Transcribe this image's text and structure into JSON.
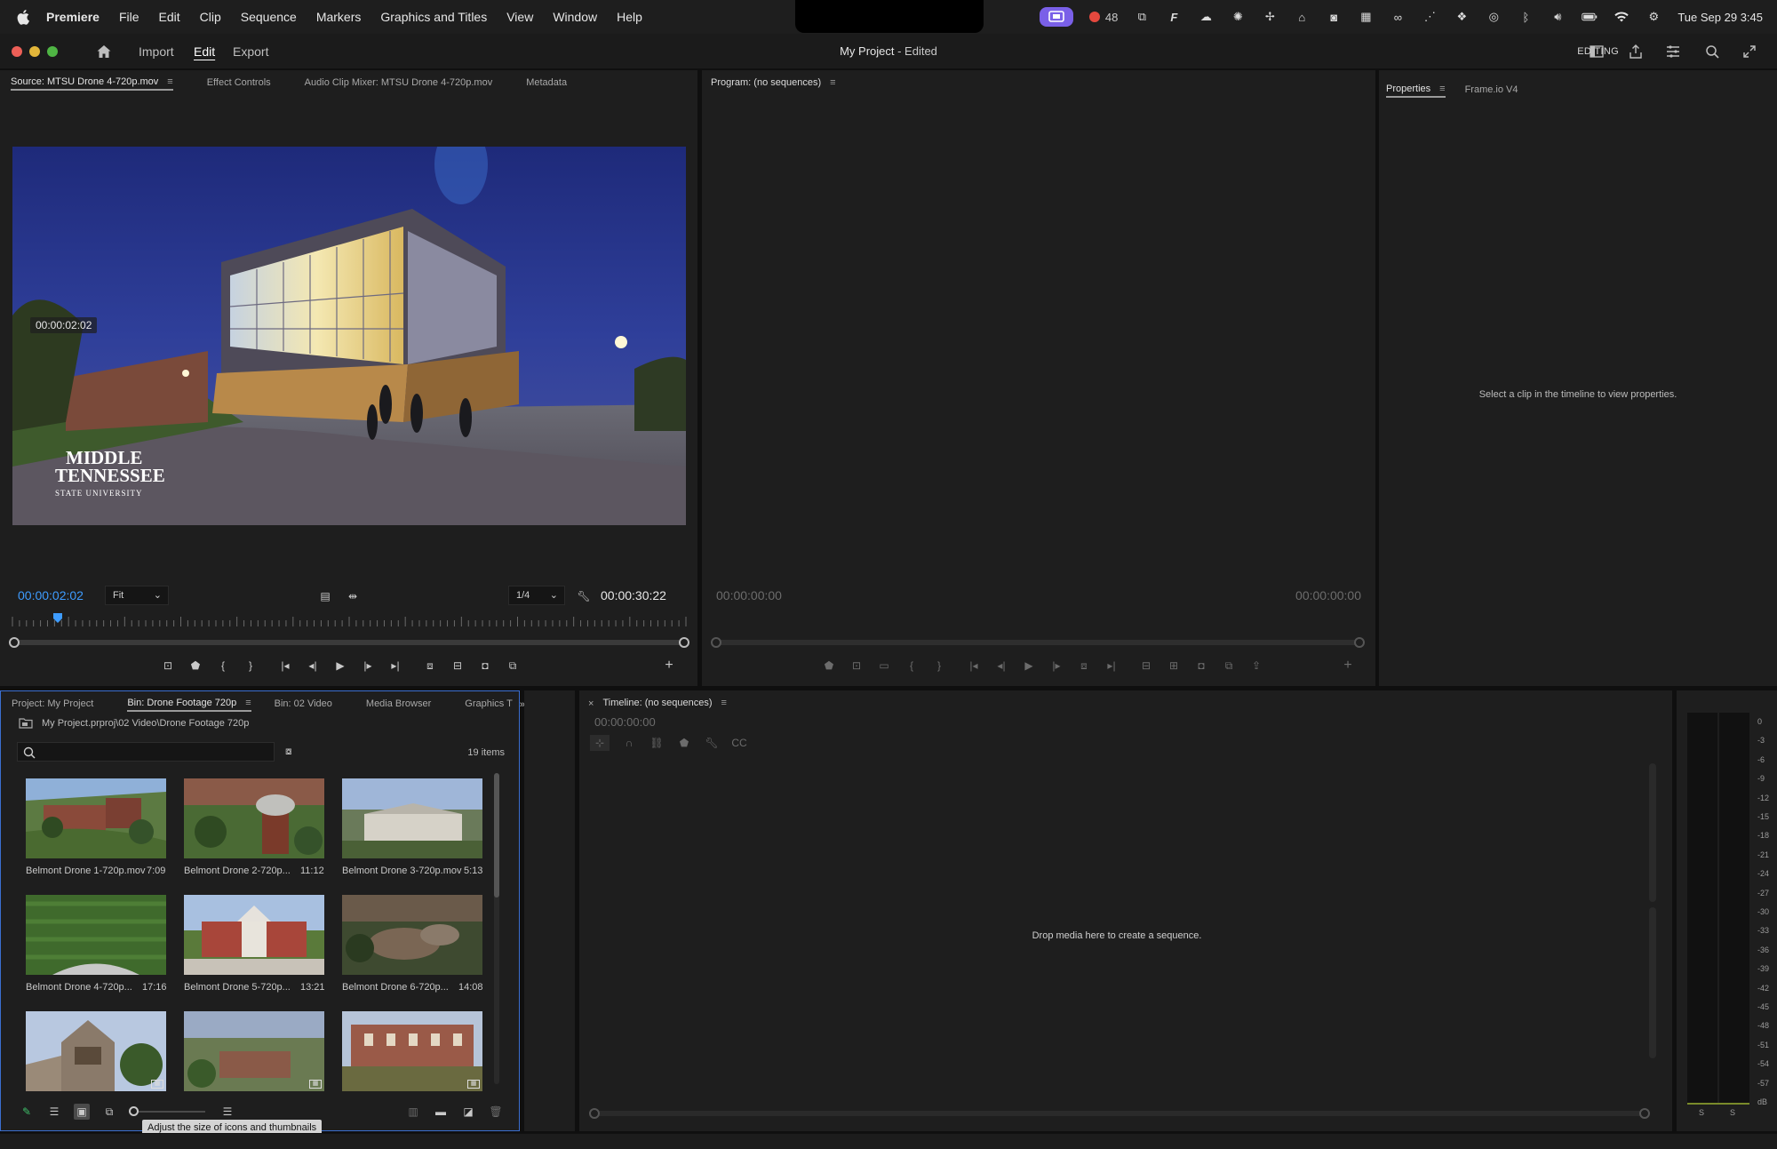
{
  "menubar": {
    "app": "Premiere",
    "items": [
      "File",
      "Edit",
      "Clip",
      "Sequence",
      "Markers",
      "Graphics and Titles",
      "View",
      "Window",
      "Help"
    ],
    "record_count": "48",
    "datetime": "Tue Sep 29  3:45"
  },
  "appbar": {
    "tabs": [
      "Import",
      "Edit",
      "Export"
    ],
    "project_name": "My Project",
    "project_status": " - Edited",
    "workspace": "EDITING"
  },
  "source_panel": {
    "tabs": [
      "Source: MTSU Drone 4-720p.mov",
      "Effect Controls",
      "Audio Clip Mixer: MTSU Drone 4-720p.mov",
      "Metadata"
    ],
    "overlay_timecode": "00:00:02:02",
    "watermark_line1": "MIDDLE",
    "watermark_line2": "TENNESSEE",
    "watermark_line3": "STATE UNIVERSITY",
    "current_timecode": "00:00:02:02",
    "zoom": "Fit",
    "resolution": "1/4",
    "duration": "00:00:30:22",
    "playhead_fraction": 0.067
  },
  "program_panel": {
    "tab": "Program: (no sequences)",
    "timecode_left": "00:00:00:00",
    "timecode_right": "00:00:00:00"
  },
  "properties_panel": {
    "tabs": [
      "Properties",
      "Frame.io V4"
    ],
    "empty_message": "Select a clip in the timeline to view properties."
  },
  "project_panel": {
    "tabs": [
      "Project: My Project",
      "Bin: Drone Footage 720p",
      "Bin: 02 Video",
      "Media Browser",
      "Graphics T"
    ],
    "path": "My Project.prproj\\02 Video\\Drone Footage 720p",
    "search_placeholder": "",
    "item_count": "19 items",
    "clips": [
      {
        "name": "Belmont Drone 1-720p.mov",
        "duration": "7:09"
      },
      {
        "name": "Belmont Drone 2-720p...",
        "duration": "11:12"
      },
      {
        "name": "Belmont Drone 3-720p.mov",
        "duration": "5:13"
      },
      {
        "name": "Belmont Drone 4-720p...",
        "duration": "17:16"
      },
      {
        "name": "Belmont Drone 5-720p...",
        "duration": "13:21"
      },
      {
        "name": "Belmont Drone 6-720p...",
        "duration": "14:08"
      }
    ],
    "tooltip": "Adjust the size of icons and thumbnails"
  },
  "timeline_panel": {
    "tab": "Timeline: (no sequences)",
    "timecode": "00:00:00:00",
    "empty_message": "Drop media here to create a sequence."
  },
  "audio_meter": {
    "scale": [
      "0",
      "-3",
      "-6",
      "-9",
      "-12",
      "-15",
      "-18",
      "-21",
      "-24",
      "-27",
      "-30",
      "-33",
      "-36",
      "-39",
      "-42",
      "-45",
      "-48",
      "-51",
      "-54",
      "-57",
      "dB"
    ],
    "solo_labels": [
      "S",
      "S"
    ]
  },
  "colors": {
    "accent_blue": "#3e9cff",
    "panel_bg": "#1e1e1e",
    "record_red": "#e5483e",
    "rec_pill": "#7a60e8",
    "selection_tool": "#2f7ff5"
  }
}
